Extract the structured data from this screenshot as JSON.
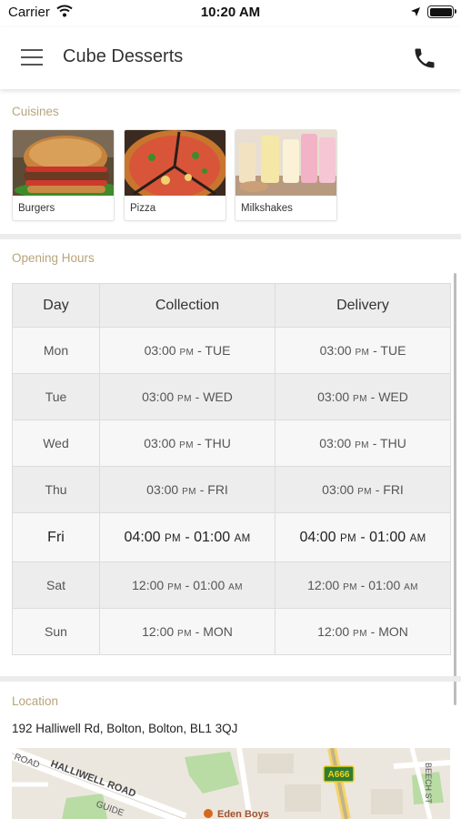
{
  "status_bar": {
    "carrier": "Carrier",
    "time": "10:20 AM"
  },
  "nav": {
    "title": "Cube Desserts",
    "menu_icon": "hamburger-menu-icon",
    "phone_icon": "phone-icon"
  },
  "cuisines": {
    "title": "Cuisines",
    "items": [
      {
        "label": "Burgers",
        "image": "burger-photo"
      },
      {
        "label": "Pizza",
        "image": "pizza-photo"
      },
      {
        "label": "Milkshakes",
        "image": "milkshake-photo"
      }
    ]
  },
  "opening_hours": {
    "title": "Opening Hours",
    "headers": [
      "Day",
      "Collection",
      "Delivery"
    ],
    "rows": [
      {
        "day": "Mon",
        "collection": {
          "time": "03:00",
          "ampm": "PM",
          "end": " - TUE"
        },
        "delivery": {
          "time": "03:00",
          "ampm": "PM",
          "end": " - TUE"
        }
      },
      {
        "day": "Tue",
        "collection": {
          "time": "03:00",
          "ampm": "PM",
          "end": " - WED"
        },
        "delivery": {
          "time": "03:00",
          "ampm": "PM",
          "end": " - WED"
        }
      },
      {
        "day": "Wed",
        "collection": {
          "time": "03:00",
          "ampm": "PM",
          "end": " - THU"
        },
        "delivery": {
          "time": "03:00",
          "ampm": "PM",
          "end": " - THU"
        }
      },
      {
        "day": "Thu",
        "collection": {
          "time": "03:00",
          "ampm": "PM",
          "end": " - FRI"
        },
        "delivery": {
          "time": "03:00",
          "ampm": "PM",
          "end": " - FRI"
        }
      },
      {
        "day": "Fri",
        "collection": {
          "time": "04:00",
          "ampm": "PM",
          "end": " - 01:00",
          "end_ampm": "AM"
        },
        "delivery": {
          "time": "04:00",
          "ampm": "PM",
          "end": " - 01:00",
          "end_ampm": "AM"
        }
      },
      {
        "day": "Sat",
        "collection": {
          "time": "12:00",
          "ampm": "PM",
          "end": " - 01:00",
          "end_ampm": "AM"
        },
        "delivery": {
          "time": "12:00",
          "ampm": "PM",
          "end": " - 01:00",
          "end_ampm": "AM"
        }
      },
      {
        "day": "Sun",
        "collection": {
          "time": "12:00",
          "ampm": "PM",
          "end": " - MON"
        },
        "delivery": {
          "time": "12:00",
          "ampm": "PM",
          "end": " - MON"
        }
      }
    ]
  },
  "location": {
    "title": "Location",
    "address": "192 Halliwell Rd, Bolton, Bolton, BL1 3QJ",
    "map": {
      "road_label_1": "ROAD",
      "road_label_2": "HALLIWELL ROAD",
      "road_label_3": "GUIDE",
      "road_badge": "A666",
      "street_label": "BEECH ST",
      "place_label": "Eden Boys"
    }
  },
  "colors": {
    "section_title": "#b8a57a",
    "road_badge_bg": "#2f7d32",
    "road_badge_text": "#f2d21a",
    "place_pin": "#d2691e"
  }
}
